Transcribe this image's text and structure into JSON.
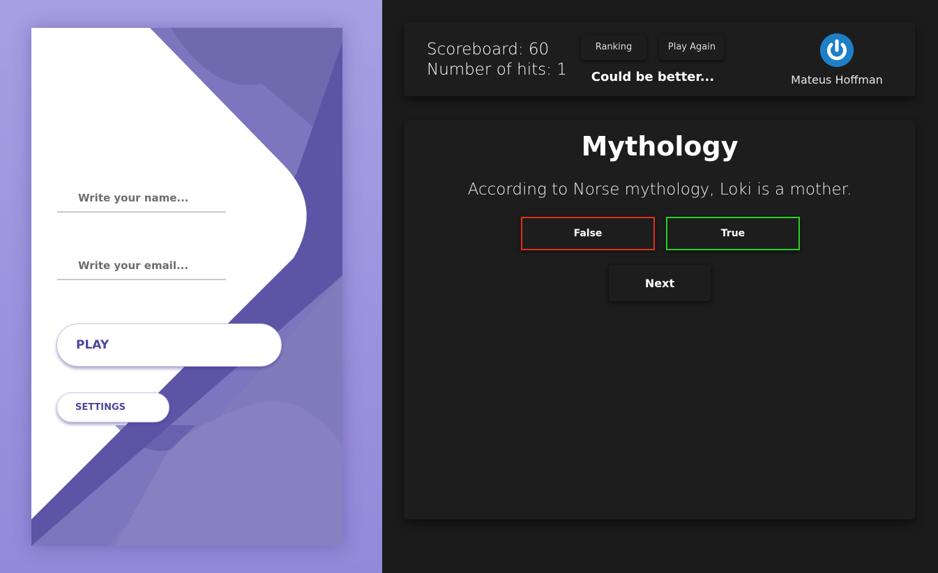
{
  "login": {
    "name_placeholder": "Write your name...",
    "email_placeholder": "Write your email...",
    "play_label": "PLAY",
    "settings_label": "SETTINGS"
  },
  "header": {
    "scoreboard_text": "Scoreboard: 60",
    "hits_text": "Number of hits: 1",
    "ranking_label": "Ranking",
    "play_again_label": "Play Again",
    "feedback": "Could be better...",
    "user_name": "Mateus Hoffman",
    "user_icon": "power-icon"
  },
  "quiz": {
    "category": "Mythology",
    "question": "According to Norse mythology, Loki is a mother.",
    "answers": [
      {
        "label": "False",
        "status": "wrong",
        "border_color": "#e33018"
      },
      {
        "label": "True",
        "status": "correct",
        "border_color": "#20d420"
      }
    ],
    "next_label": "Next"
  },
  "colors": {
    "left_background": "#9d95e0",
    "brand_purple": "#4c489a",
    "dark_background": "#1b1b1b",
    "card_background": "#1d1d1d",
    "icon_blue": "#1e7fc9"
  }
}
